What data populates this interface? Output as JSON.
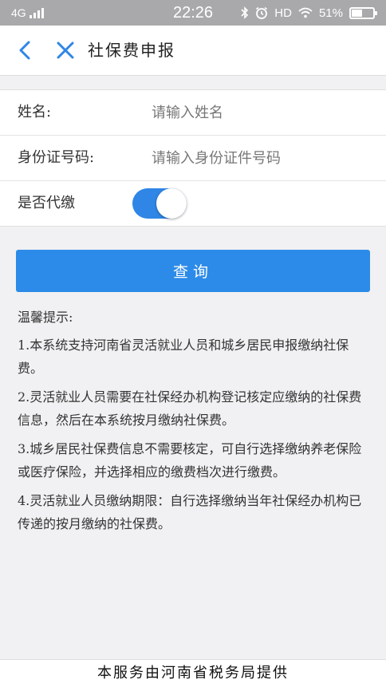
{
  "status_bar": {
    "network": "4G",
    "time": "22:26",
    "hd": "HD",
    "battery": "51%",
    "battery_level": 0.51
  },
  "header": {
    "title": "社保费申报"
  },
  "form": {
    "name_label": "姓名:",
    "name_placeholder": "请输入姓名",
    "id_label": "身份证号码:",
    "id_placeholder": "请输入身份证件号码",
    "proxy_label": "是否代缴",
    "proxy_on": true
  },
  "query_button": "查询",
  "tips": {
    "title": "温馨提示:",
    "items": [
      "1.本系统支持河南省灵活就业人员和城乡居民申报缴纳社保费。",
      "2.灵活就业人员需要在社保经办机构登记核定应缴纳的社保费信息，然后在本系统按月缴纳社保费。",
      "3.城乡居民社保费信息不需要核定，可自行选择缴纳养老保险或医疗保险，并选择相应的缴费档次进行缴费。",
      "4.灵活就业人员缴纳期限：自行选择缴纳当年社保经办机构已传递的按月缴纳的社保费。"
    ]
  },
  "footer": "本服务由河南省税务局提供",
  "colors": {
    "accent": "#2c8be8",
    "status_bar": "#a9a9ab"
  }
}
